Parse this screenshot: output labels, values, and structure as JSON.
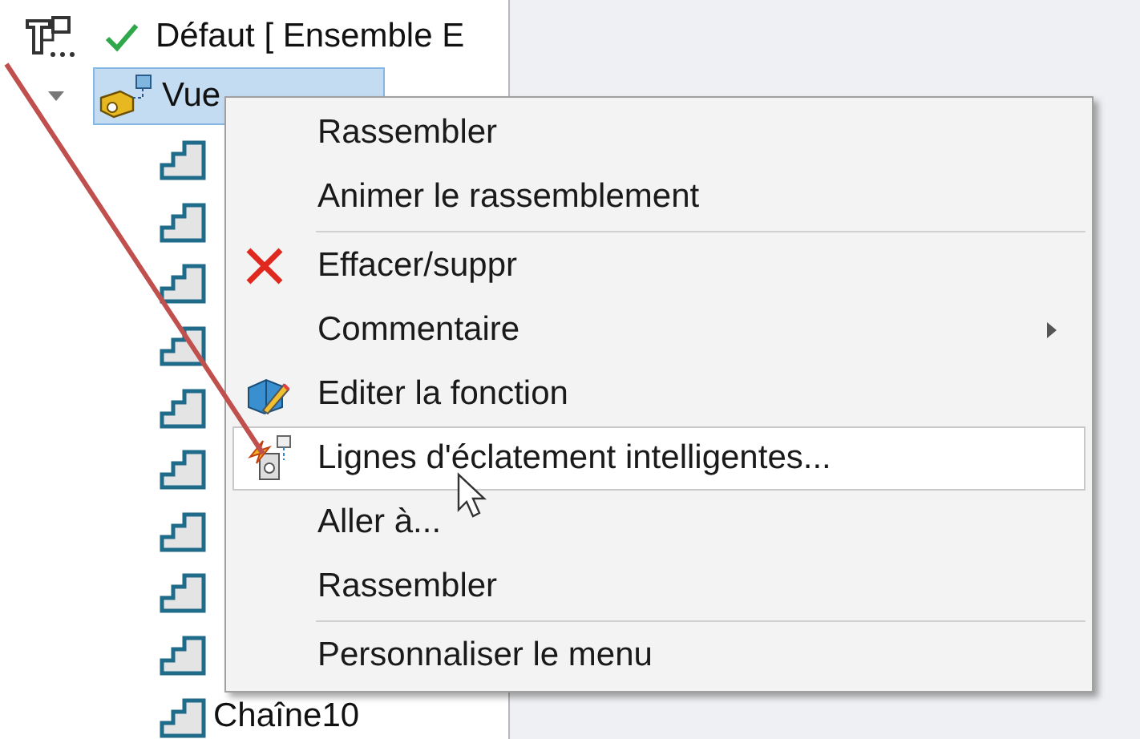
{
  "tree": {
    "configuration": {
      "label": "Défaut [ Ensemble E"
    },
    "exploded_view": {
      "label": "Vue",
      "expanded": true,
      "selected": true,
      "children": [
        {
          "kind": "sketch"
        },
        {
          "kind": "sketch"
        },
        {
          "kind": "sketch"
        },
        {
          "kind": "sketch"
        },
        {
          "kind": "sketch"
        },
        {
          "kind": "sketch"
        },
        {
          "kind": "sketch"
        },
        {
          "kind": "sketch"
        },
        {
          "kind": "sketch"
        },
        {
          "kind": "sketch",
          "label": "Chaîne10"
        }
      ]
    }
  },
  "context_menu": {
    "items": [
      {
        "kind": "item",
        "label": "Rassembler",
        "submenu": false,
        "highlighted": false
      },
      {
        "kind": "item",
        "label": "Animer le rassemblement",
        "submenu": false,
        "highlighted": false
      },
      {
        "kind": "separator"
      },
      {
        "kind": "delete",
        "label": "Effacer/suppr",
        "submenu": false,
        "highlighted": false
      },
      {
        "kind": "item",
        "label": "Commentaire",
        "submenu": true,
        "highlighted": false
      },
      {
        "kind": "edit",
        "label": "Editer la fonction",
        "submenu": false,
        "highlighted": false
      },
      {
        "kind": "smart-lines",
        "label": "Lignes d'éclatement intelligentes...",
        "submenu": false,
        "highlighted": true
      },
      {
        "kind": "item",
        "label": "Aller à...",
        "submenu": false,
        "highlighted": false
      },
      {
        "kind": "item",
        "label": "Rassembler",
        "submenu": false,
        "highlighted": false
      },
      {
        "kind": "separator"
      },
      {
        "kind": "item",
        "label": "Personnaliser le menu",
        "submenu": false,
        "highlighted": false
      }
    ]
  }
}
